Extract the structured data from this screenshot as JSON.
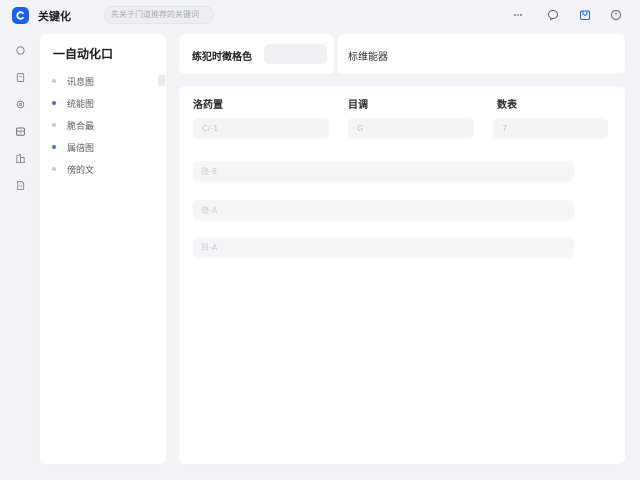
{
  "app": {
    "title": "关键化",
    "search_placeholder": "先关于门道推荐的关键词"
  },
  "topbar_icons": [
    "more-icon",
    "chat-icon",
    "inbox-icon",
    "help-icon"
  ],
  "rail_icons": [
    "home-icon",
    "doc-icon",
    "gear-icon",
    "archive-icon",
    "building-icon",
    "file-icon"
  ],
  "sidebar": {
    "title": "一自动化口",
    "items": [
      {
        "label": "讯息图",
        "dot": "gray"
      },
      {
        "label": "统能图",
        "dot": "blue"
      },
      {
        "label": "脆合最",
        "dot": "gray"
      },
      {
        "label": "属倍图",
        "dot": "blue"
      },
      {
        "label": "傍的文",
        "dot": "gray"
      }
    ]
  },
  "header": {
    "card1_label": "练犯时徵格色",
    "card2_label": "标维能器"
  },
  "main": {
    "columns": [
      "洛药置",
      "目调",
      "数表"
    ],
    "column_cells": [
      "C/-1",
      "G",
      "7"
    ],
    "rows": [
      "隐-8",
      "隐-A",
      "目-A"
    ]
  },
  "colors": {
    "accent": "#1e62ec",
    "dot_blue": "#4e71d6",
    "background": "#f3f4f7"
  }
}
